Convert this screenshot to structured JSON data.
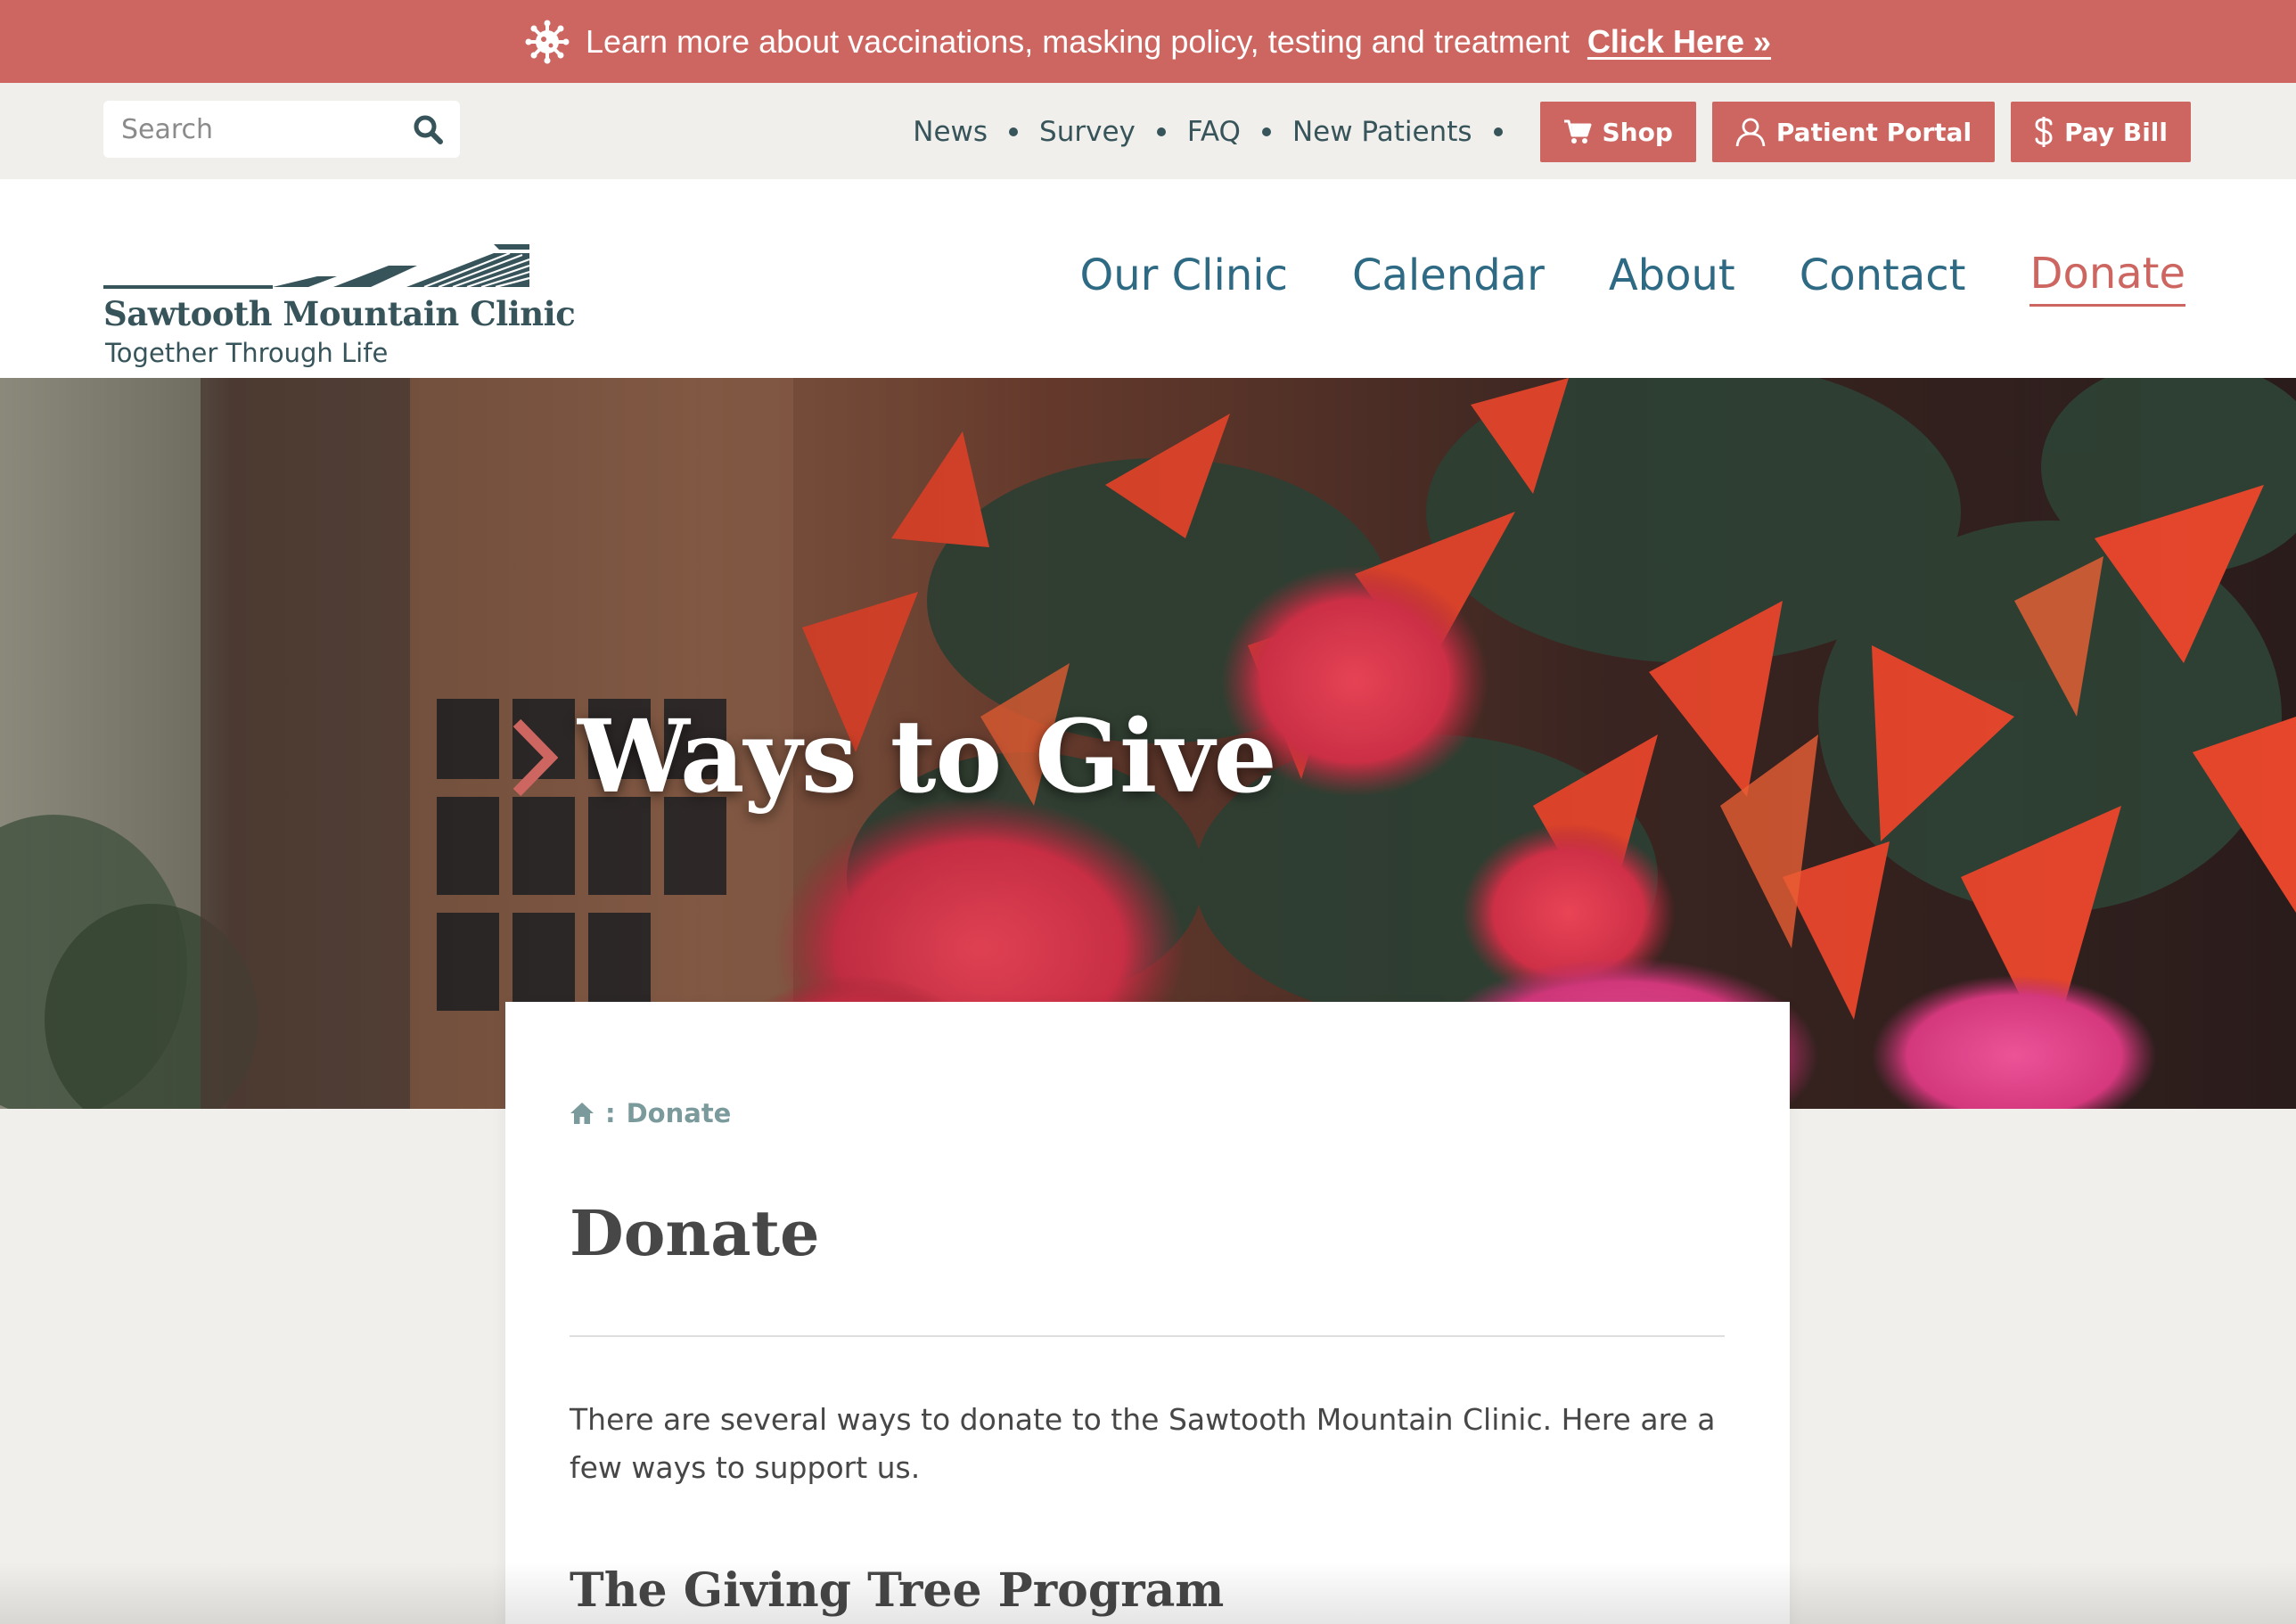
{
  "alert": {
    "icon": "virus-icon",
    "text": "Learn more about vaccinations, masking policy, testing and treatment",
    "link_label": "Click Here »"
  },
  "utility": {
    "search": {
      "placeholder": "Search",
      "value": ""
    },
    "links": [
      "News",
      "Survey",
      "FAQ",
      "New Patients"
    ],
    "buttons": {
      "shop": "Shop",
      "portal": "Patient Portal",
      "pay": "Pay Bill"
    }
  },
  "header": {
    "logo_name": "Sawtooth Mountain Clinic",
    "logo_tagline": "Together Through Life",
    "nav": {
      "our_clinic": "Our Clinic",
      "calendar": "Calendar",
      "about": "About",
      "contact": "Contact",
      "donate": "Donate"
    },
    "active": "Donate"
  },
  "hero": {
    "title": "Ways to Give"
  },
  "content": {
    "breadcrumb": {
      "separator": ":",
      "current": "Donate"
    },
    "title": "Donate",
    "intro": "There are several ways to donate to the Sawtooth Mountain Clinic. Here are a few ways to support us.",
    "section_heading": "The Giving Tree Program"
  },
  "colors": {
    "accent": "#cd6661",
    "nav_blue": "#2e6a83",
    "teal_dark": "#37545a",
    "page_bg": "#f1efeb",
    "text": "#474747"
  }
}
